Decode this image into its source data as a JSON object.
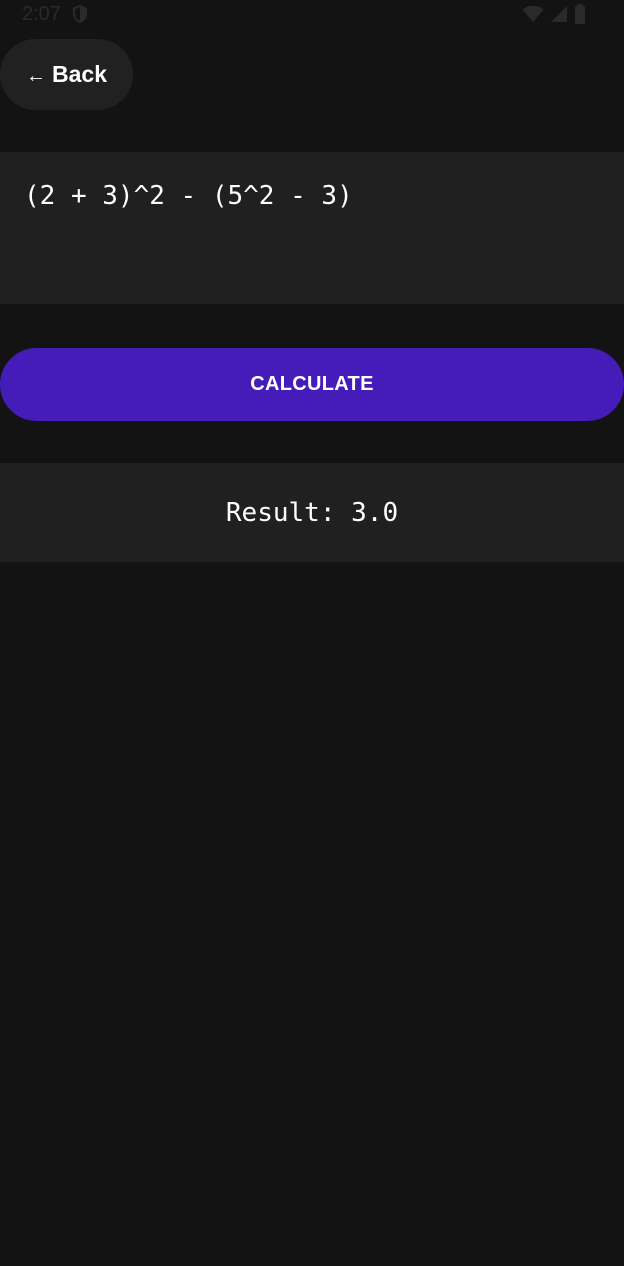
{
  "status_bar": {
    "time": "2:07",
    "icons": [
      "shield-icon",
      "wifi-icon",
      "signal-icon",
      "battery-icon"
    ]
  },
  "back_button": {
    "arrow": "←",
    "label": "Back"
  },
  "expression": {
    "value": "(2 + 3)^2 - (5^2 - 3)"
  },
  "calculate_button": {
    "label": "CALCULATE"
  },
  "result": {
    "text": "Result: 3.0"
  },
  "colors": {
    "background": "#131313",
    "surface": "#202020",
    "accent": "#451bba",
    "text": "#ffffff"
  }
}
